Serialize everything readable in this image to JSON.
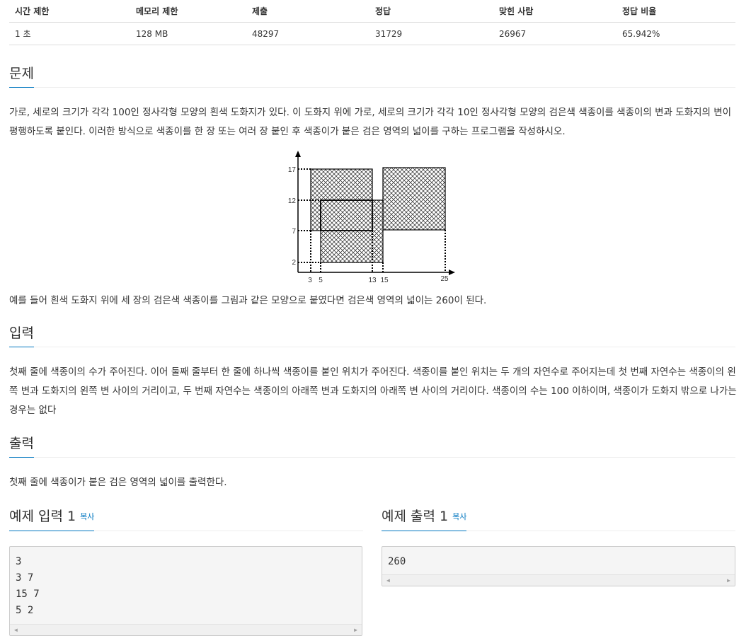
{
  "info": {
    "headers": [
      "시간 제한",
      "메모리 제한",
      "제출",
      "정답",
      "맞힌 사람",
      "정답 비율"
    ],
    "values": [
      "1 초",
      "128 MB",
      "48297",
      "31729",
      "26967",
      "65.942%"
    ]
  },
  "problem": {
    "title": "문제",
    "description_1": "가로, 세로의 크기가 각각 100인 정사각형 모양의 흰색 도화지가 있다. 이 도화지 위에 가로, 세로의 크기가 각각 10인 정사각형 모양의 검은색 색종이를 색종이의 변과 도화지의 변이 평행하도록 붙인다. 이러한 방식으로 색종이를 한 장 또는 여러 장 붙인 후 색종이가 붙은 검은 영역의 넓이를 구하는 프로그램을 작성하시오.",
    "description_2": "예를 들어 흰색 도화지 위에 세 장의 검은색 색종이를 그림과 같은 모양으로 붙였다면 검은색 영역의 넓이는 260이 된다."
  },
  "figure": {
    "y_ticks": [
      "17",
      "12",
      "7",
      "2"
    ],
    "x_ticks": [
      "3",
      "5",
      "13",
      "15",
      "25"
    ]
  },
  "input": {
    "title": "입력",
    "description": "첫째 줄에 색종이의 수가 주어진다. 이어 둘째 줄부터 한 줄에 하나씩 색종이를 붙인 위치가 주어진다. 색종이를 붙인 위치는 두 개의 자연수로 주어지는데 첫 번째 자연수는 색종이의 왼쪽 변과 도화지의 왼쪽 변 사이의 거리이고, 두 번째 자연수는 색종이의 아래쪽 변과 도화지의 아래쪽 변 사이의 거리이다. 색종이의 수는 100 이하이며, 색종이가 도화지 밖으로 나가는 경우는 없다"
  },
  "output": {
    "title": "출력",
    "description": "첫째 줄에 색종이가 붙은 검은 영역의 넓이를 출력한다."
  },
  "sample_input": {
    "title": "예제 입력 1",
    "copy_label": "복사",
    "content": "3\n3 7\n15 7\n5 2"
  },
  "sample_output": {
    "title": "예제 출력 1",
    "copy_label": "복사",
    "content": "260"
  }
}
